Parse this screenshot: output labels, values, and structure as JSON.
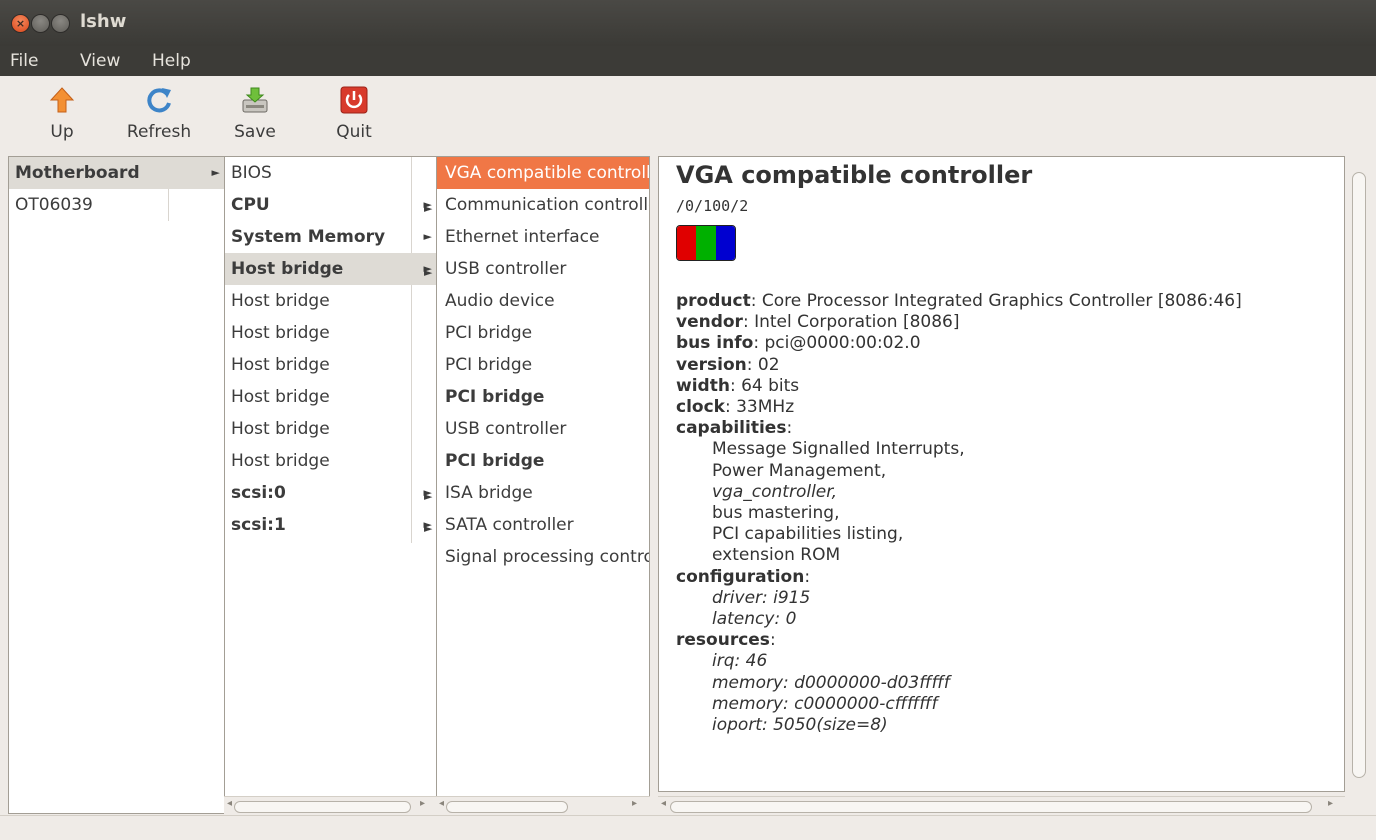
{
  "window": {
    "title": "lshw",
    "close_glyph": "×"
  },
  "menu": [
    "File",
    "View",
    "Help"
  ],
  "toolbar": {
    "up": {
      "label": "Up",
      "icon": "up-arrow-icon"
    },
    "refresh": {
      "label": "Refresh",
      "icon": "refresh-icon"
    },
    "save": {
      "label": "Save",
      "icon": "save-icon"
    },
    "quit": {
      "label": "Quit",
      "icon": "power-icon"
    }
  },
  "column1": {
    "items": [
      {
        "label": "Motherboard",
        "bold": true,
        "arrow": true,
        "state": "highlight"
      },
      {
        "label": "OT06039",
        "bold": false,
        "arrow": false,
        "state": ""
      }
    ]
  },
  "column2": {
    "items": [
      {
        "label": "BIOS",
        "bold": false,
        "arrow": false,
        "state": ""
      },
      {
        "label": "CPU",
        "bold": true,
        "arrow": true,
        "state": ""
      },
      {
        "label": "System Memory",
        "bold": true,
        "arrow": true,
        "state": ""
      },
      {
        "label": "Host bridge",
        "bold": true,
        "arrow": true,
        "state": "highlight"
      },
      {
        "label": "Host bridge",
        "bold": false,
        "arrow": false,
        "state": ""
      },
      {
        "label": "Host bridge",
        "bold": false,
        "arrow": false,
        "state": ""
      },
      {
        "label": "Host bridge",
        "bold": false,
        "arrow": false,
        "state": ""
      },
      {
        "label": "Host bridge",
        "bold": false,
        "arrow": false,
        "state": ""
      },
      {
        "label": "Host bridge",
        "bold": false,
        "arrow": false,
        "state": ""
      },
      {
        "label": "Host bridge",
        "bold": false,
        "arrow": false,
        "state": ""
      },
      {
        "label": "scsi:0",
        "bold": true,
        "arrow": true,
        "state": ""
      },
      {
        "label": "scsi:1",
        "bold": true,
        "arrow": true,
        "state": ""
      }
    ]
  },
  "column3": {
    "items": [
      {
        "label": "VGA compatible controller",
        "bold": false,
        "arrow": false,
        "state": "selected"
      },
      {
        "label": "Communication controller",
        "bold": false,
        "arrow": false,
        "state": ""
      },
      {
        "label": "Ethernet interface",
        "bold": false,
        "arrow": false,
        "state": ""
      },
      {
        "label": "USB controller",
        "bold": false,
        "arrow": false,
        "state": ""
      },
      {
        "label": "Audio device",
        "bold": false,
        "arrow": false,
        "state": ""
      },
      {
        "label": "PCI bridge",
        "bold": false,
        "arrow": false,
        "state": ""
      },
      {
        "label": "PCI bridge",
        "bold": false,
        "arrow": false,
        "state": ""
      },
      {
        "label": "PCI bridge",
        "bold": true,
        "arrow": false,
        "state": ""
      },
      {
        "label": "USB controller",
        "bold": false,
        "arrow": false,
        "state": ""
      },
      {
        "label": "PCI bridge",
        "bold": true,
        "arrow": false,
        "state": ""
      },
      {
        "label": "ISA bridge",
        "bold": false,
        "arrow": false,
        "state": ""
      },
      {
        "label": "SATA controller",
        "bold": false,
        "arrow": false,
        "state": ""
      },
      {
        "label": "Signal processing controller",
        "bold": false,
        "arrow": false,
        "state": ""
      }
    ],
    "arrow_rows": [
      1,
      3,
      10,
      11
    ]
  },
  "detail": {
    "title": "VGA compatible controller",
    "path": "/0/100/2",
    "logo_icon": "display-rgb-icon",
    "logo_colors": [
      "#e00000",
      "#00b000",
      "#0000d0"
    ],
    "product_key": "product",
    "product_val": "Core Processor Integrated Graphics Controller [8086:46]",
    "vendor_key": "vendor",
    "vendor_val": "Intel Corporation [8086]",
    "businfo_key": "bus info",
    "businfo_val": "pci@0000:00:02.0",
    "version_key": "version",
    "version_val": "02",
    "width_key": "width",
    "width_val": "64 bits",
    "clock_key": "clock",
    "clock_val": "33MHz",
    "capabilities_key": "capabilities",
    "capabilities": [
      {
        "text": "Message Signalled Interrupts,",
        "italic": false
      },
      {
        "text": "Power Management,",
        "italic": false
      },
      {
        "text": "vga_controller,",
        "italic": true
      },
      {
        "text": "bus mastering,",
        "italic": false
      },
      {
        "text": "PCI capabilities listing,",
        "italic": false
      },
      {
        "text": "extension ROM",
        "italic": false
      }
    ],
    "configuration_key": "configuration",
    "configuration": [
      "driver: i915",
      "latency: 0"
    ],
    "resources_key": "resources",
    "resources": [
      "irq: 46",
      "memory: d0000000-d03fffff",
      "memory: c0000000-cfffffff",
      "ioport: 5050(size=8)"
    ],
    "sep": ":"
  },
  "colors": {
    "accent": "#f07746",
    "highlight": "#dedbd5"
  }
}
